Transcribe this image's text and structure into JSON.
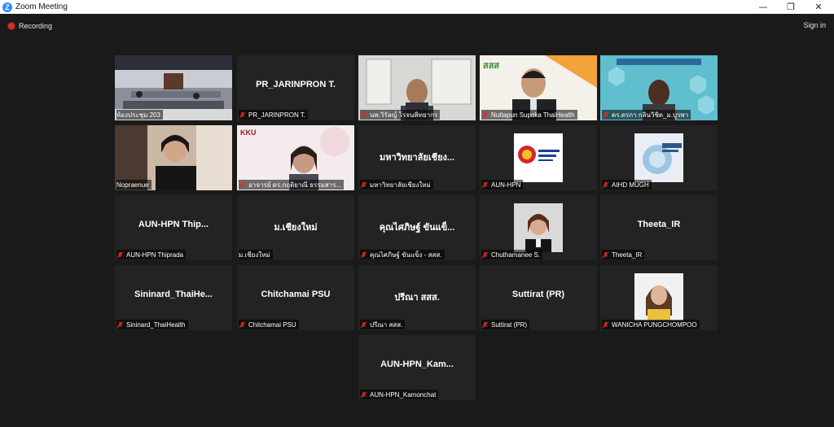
{
  "window": {
    "title": "Zoom Meeting",
    "minimize": "—",
    "restore": "❐",
    "close": "✕"
  },
  "toolbar": {
    "recording": "Recording",
    "sign_in": "Sign in"
  },
  "tiles": [
    {
      "label": "ห้องประชุม 203",
      "center": "",
      "muted": false
    },
    {
      "label": "PR_JARINPRON T.",
      "center": "PR_JARINPRON T.",
      "muted": true
    },
    {
      "label": "นพ.วิรัลญ์ โรจนพิทยากร",
      "center": "",
      "muted": true
    },
    {
      "label": "Nuttapun Supaka ThaiHealth",
      "center": "",
      "muted": true
    },
    {
      "label": "ดร.ดรกา กลินวิชิต_ม.บูรพา",
      "center": "",
      "muted": true
    },
    {
      "label": "Nopraenue",
      "center": "",
      "muted": false
    },
    {
      "label": "อาจารย์ ดร.กฤติยาณี ธรรมสาร...",
      "center": "",
      "muted": true
    },
    {
      "label": "มหาวิทยาลัยเชียงใหม่",
      "center": "มหาวิทยาลัยเชียง...",
      "muted": true
    },
    {
      "label": "AUN-HPN",
      "center": "",
      "muted": true
    },
    {
      "label": "AIHD MUGH",
      "center": "",
      "muted": true
    },
    {
      "label": "AUN-HPN  Thiprada",
      "center": "AUN-HPN   Thip...",
      "muted": true
    },
    {
      "label": "ม.เชียงใหม่",
      "center": "ม.เชียงใหม่",
      "muted": false
    },
    {
      "label": "คุณไศภิษฐ์ ขันแข็ง - สสส.",
      "center": "คุณไศภิษฐ์ ขันแข็...",
      "muted": true
    },
    {
      "label": "Chuthamanee S.",
      "center": "",
      "muted": true
    },
    {
      "label": "Theeta_IR",
      "center": "Theeta_IR",
      "muted": true
    },
    {
      "label": "Sininard_ThaiHealth",
      "center": "Sininard_ThaiHe...",
      "muted": true
    },
    {
      "label": "Chitchamai PSU",
      "center": "Chitchamai PSU",
      "muted": true
    },
    {
      "label": "ปรีณา สสส.",
      "center": "ปรีณา สสส.",
      "muted": true
    },
    {
      "label": "Suttirat (PR)",
      "center": "Suttirat (PR)",
      "muted": true
    },
    {
      "label": "WANICHA PUNGCHOMPOO",
      "center": "",
      "muted": true
    },
    {
      "label": "AUN-HPN_Kamonchat",
      "center": "AUN-HPN_Kam...",
      "muted": true
    }
  ],
  "logos": {
    "kku": "KKU",
    "aun": "ASEAN University Network",
    "sss": "สสส"
  },
  "colors": {
    "active_border": "#b6e25a",
    "muted_icon": "#e02828",
    "tile_bg": "#232323",
    "zoom_blue": "#2d8cff"
  }
}
